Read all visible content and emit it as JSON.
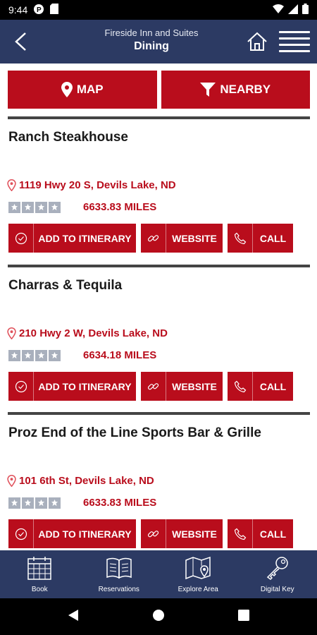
{
  "status_bar": {
    "time": "9:44"
  },
  "header": {
    "subtitle": "Fireside Inn and Suites",
    "title": "Dining"
  },
  "actions": {
    "map_label": "MAP",
    "nearby_label": "NEARBY"
  },
  "listings": [
    {
      "name": "Ranch Steakhouse",
      "address": "1119 Hwy 20 S, Devils Lake, ND",
      "rating_stars": 4,
      "distance": "6633.83 MILES",
      "itinerary_label": "ADD TO ITINERARY",
      "website_label": "WEBSITE",
      "call_label": "CALL"
    },
    {
      "name": "Charras & Tequila",
      "address": "210 Hwy 2 W, Devils Lake, ND",
      "rating_stars": 4,
      "distance": "6634.18 MILES",
      "itinerary_label": "ADD TO ITINERARY",
      "website_label": "WEBSITE",
      "call_label": "CALL"
    },
    {
      "name": "Proz End of the Line Sports Bar & Grille",
      "address": "101 6th St, Devils Lake, ND",
      "rating_stars": 4,
      "distance": "6633.83 MILES",
      "itinerary_label": "ADD TO ITINERARY",
      "website_label": "WEBSITE",
      "call_label": "CALL"
    }
  ],
  "bottom_nav": {
    "book": "Book",
    "reservations": "Reservations",
    "explore": "Explore Area",
    "digital_key": "Digital Key"
  },
  "colors": {
    "header_bg": "#2c3a63",
    "accent_red": "#b90d1c",
    "star_gray": "#a9b0bd"
  }
}
